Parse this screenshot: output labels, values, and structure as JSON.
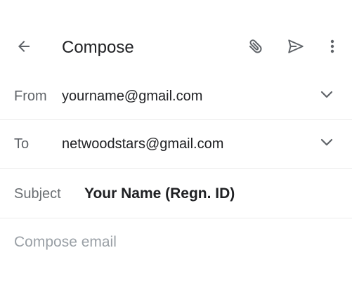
{
  "app_bar": {
    "back_icon": "arrow-back-icon",
    "title": "Compose",
    "attach_icon": "paperclip-icon",
    "send_icon": "send-icon",
    "more_icon": "more-vertical-icon"
  },
  "fields": {
    "from": {
      "label": "From",
      "value": "yourname@gmail.com",
      "dropdown_icon": "chevron-down-icon"
    },
    "to": {
      "label": "To",
      "value": "netwoodstars@gmail.com",
      "dropdown_icon": "chevron-down-icon"
    },
    "subject": {
      "label": "Subject",
      "value": "Your Name (Regn. ID)"
    }
  },
  "body": {
    "placeholder": "Compose email"
  },
  "colors": {
    "text_primary": "#202124",
    "text_secondary": "#5f6368",
    "placeholder": "#9aa0a6",
    "divider": "#ececec",
    "icon": "#5f6368"
  }
}
